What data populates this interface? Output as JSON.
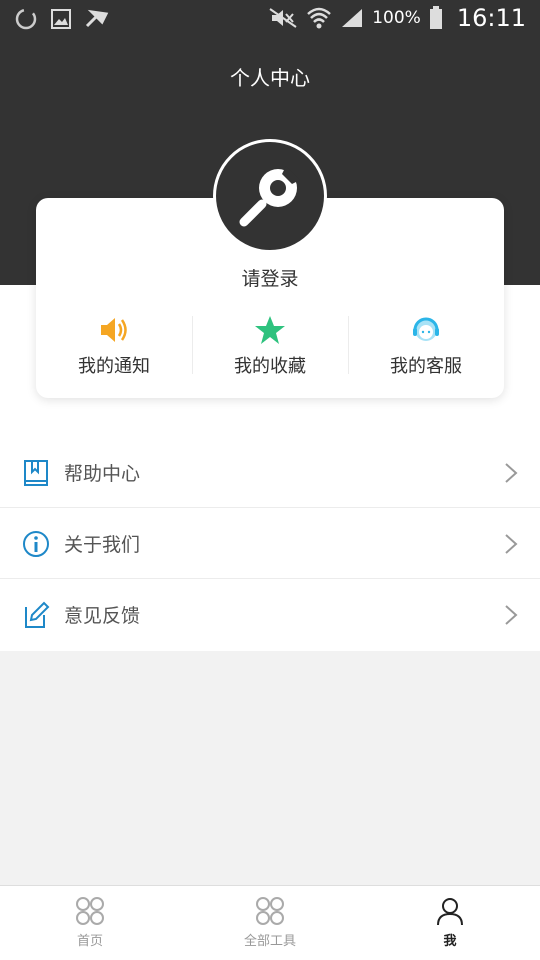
{
  "status_bar": {
    "battery": "100%",
    "time": "16:11"
  },
  "header": {
    "title": "个人中心"
  },
  "profile": {
    "login_prompt": "请登录",
    "quick_actions": [
      {
        "label": "我的通知",
        "icon": "speaker-icon",
        "color": "#f5a623"
      },
      {
        "label": "我的收藏",
        "icon": "star-icon",
        "color": "#2ec27e"
      },
      {
        "label": "我的客服",
        "icon": "customer-service-icon",
        "color": "#2bb5e8"
      }
    ]
  },
  "menu": {
    "items": [
      {
        "label": "帮助中心",
        "icon": "book-icon"
      },
      {
        "label": "关于我们",
        "icon": "info-icon"
      },
      {
        "label": "意见反馈",
        "icon": "edit-icon"
      }
    ]
  },
  "tabbar": {
    "tabs": [
      {
        "label": "首页",
        "icon": "home-grid-icon",
        "active": false
      },
      {
        "label": "全部工具",
        "icon": "tools-grid-icon",
        "active": false
      },
      {
        "label": "我",
        "icon": "user-icon",
        "active": true
      }
    ]
  },
  "colors": {
    "header_bg": "#333333",
    "menu_icon": "#1e88c8",
    "page_bg": "#f2f2f2"
  }
}
